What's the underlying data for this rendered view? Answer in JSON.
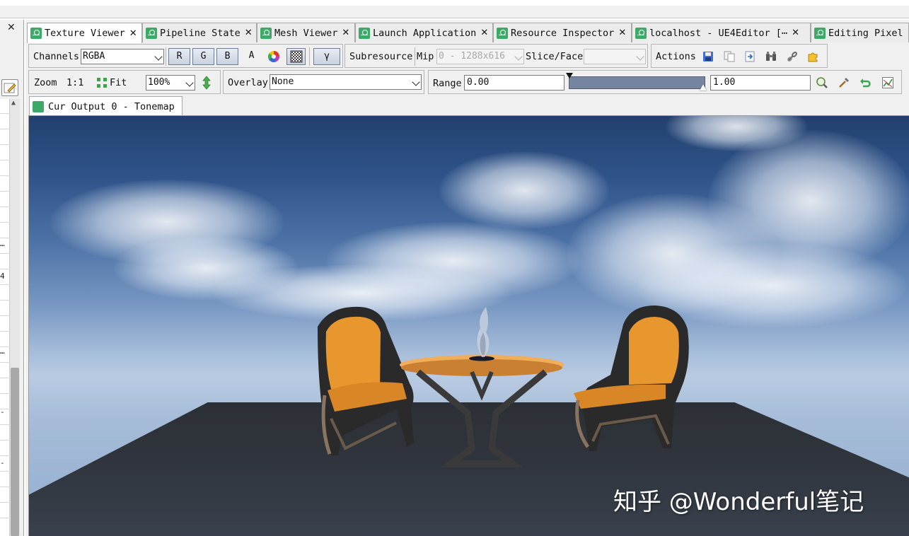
{
  "left_panel": {
    "close_glyph": "✕",
    "visible_glyphs": [
      "…",
      "4",
      "…",
      "-",
      "-"
    ]
  },
  "tabs": [
    {
      "label": "Texture Viewer",
      "active": true
    },
    {
      "label": "Pipeline State",
      "active": false
    },
    {
      "label": "Mesh Viewer",
      "active": false
    },
    {
      "label": "Launch Application",
      "active": false
    },
    {
      "label": "Resource Inspector",
      "active": false
    },
    {
      "label": "localhost - UE4Editor [⋯",
      "active": false
    },
    {
      "label": "Editing Pixel",
      "active": false
    }
  ],
  "tab_close_glyph": "✕",
  "toolbar1": {
    "channels_label": "Channels",
    "channels_value": "RGBA",
    "r_label": "R",
    "g_label": "G",
    "b_label": "B",
    "a_label": "A",
    "gamma_label": "γ",
    "subresource_label": "Subresource",
    "mip_label": "Mip",
    "mip_value": "0 - 1288x616",
    "slice_label": "Slice/Face",
    "slice_value": "",
    "actions_label": "Actions"
  },
  "toolbar2": {
    "zoom_label": "Zoom",
    "zoom_1to1": "1:1",
    "fit_label": "Fit",
    "zoom_value": "100%",
    "overlay_label": "Overlay",
    "overlay_value": "None",
    "range_label": "Range",
    "range_min": "0.00",
    "range_max": "1.00"
  },
  "document_tab": {
    "label": "Cur Output 0 - Tonemap"
  },
  "viewport": {
    "watermark": "知乎 @Wonderful笔记"
  },
  "colors": {
    "tab_icon": "#3ea866",
    "range_bar": "#7585a0",
    "chair_seat": "#e8962e",
    "table_top": "#e9a04c"
  },
  "icons": [
    "colour-wheel-icon",
    "checkerboard-icon",
    "save-icon",
    "copy-icon",
    "open-external-icon",
    "binoculars-icon",
    "link-icon",
    "puzzle-icon",
    "fit-icon",
    "flip-icon",
    "zoom-range-icon",
    "pick-icon",
    "reset-icon",
    "histogram-icon"
  ]
}
